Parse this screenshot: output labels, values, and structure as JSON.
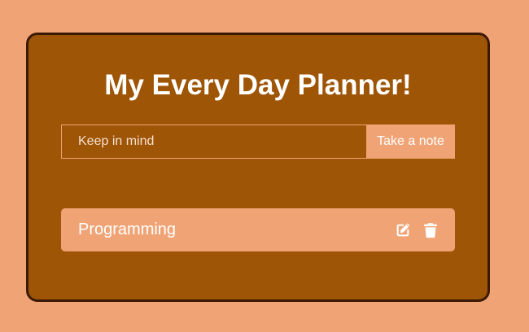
{
  "app": {
    "title": "My Every Day Planner!"
  },
  "form": {
    "input_placeholder": "Keep in mind",
    "input_value": "",
    "submit_label": "Take a note"
  },
  "todos": [
    {
      "text": "Programming",
      "edit_icon": "edit-icon",
      "delete_icon": "trash-icon"
    }
  ],
  "colors": {
    "page_background": "#f0a476",
    "panel_background": "#9e5506",
    "panel_border": "#3b1a05",
    "accent": "#f0a476",
    "text": "#ffffff"
  }
}
